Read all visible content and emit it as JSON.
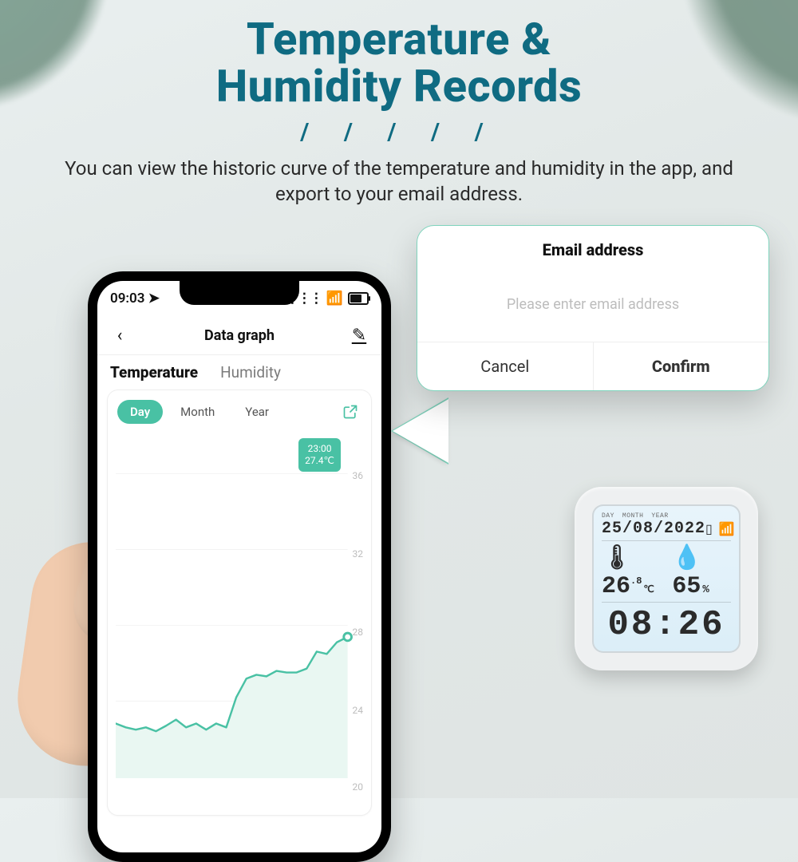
{
  "headline": {
    "line1": "Temperature &",
    "line2": "Humidity Records",
    "slashes": "/ / / / /",
    "subtitle": "You can view the historic curve of the temperature and  humidity in the app, and export to your email address."
  },
  "phone": {
    "statusbar": {
      "time": "09:03",
      "location_glyph": "➤",
      "signal_glyph": "⋮⋮⋮",
      "wifi_glyph": "📶",
      "battery_glyph": "▮"
    },
    "appbar": {
      "back_glyph": "‹",
      "title": "Data graph",
      "edit_glyph": "✎"
    },
    "tabs": {
      "temperature": "Temperature",
      "humidity": "Humidity"
    },
    "range": {
      "day": "Day",
      "month": "Month",
      "year": "Year"
    },
    "export_icon_name": "export-share-icon",
    "tooltip": {
      "time": "23:00",
      "value": "27.4℃"
    }
  },
  "chart_data": {
    "type": "line",
    "title": "Temperature",
    "xlabel": "",
    "ylabel": "",
    "ylim": [
      20,
      36
    ],
    "y_ticks": [
      20,
      24,
      28,
      32,
      36
    ],
    "tooltip": {
      "x": "23:00",
      "y": 27.4
    },
    "series": [
      {
        "name": "Temperature (°C)",
        "x_hours": [
          0,
          1,
          2,
          3,
          4,
          5,
          6,
          7,
          8,
          9,
          10,
          11,
          12,
          13,
          14,
          15,
          16,
          17,
          18,
          19,
          20,
          21,
          22,
          23
        ],
        "values": [
          22.8,
          22.6,
          22.5,
          22.6,
          22.4,
          22.7,
          23.0,
          22.6,
          22.8,
          22.5,
          22.8,
          22.6,
          24.2,
          25.2,
          25.4,
          25.3,
          25.6,
          25.5,
          25.5,
          25.7,
          26.6,
          26.5,
          27.1,
          27.4
        ]
      }
    ]
  },
  "popover": {
    "title": "Email address",
    "placeholder": "Please enter email address",
    "cancel": "Cancel",
    "confirm": "Confirm"
  },
  "device": {
    "labels": {
      "day": "DAY",
      "month": "MONTH",
      "year": "YEAR"
    },
    "date": "25/08/2022",
    "battery_glyph": "▯",
    "wifi_glyph": "📶",
    "thermo_glyph": "🌡",
    "drop_glyph": "💧",
    "temp_main": "26",
    "temp_dec": ".8",
    "temp_unit": "℃",
    "humidity": "65",
    "humidity_unit": "%",
    "time": "08:26"
  }
}
